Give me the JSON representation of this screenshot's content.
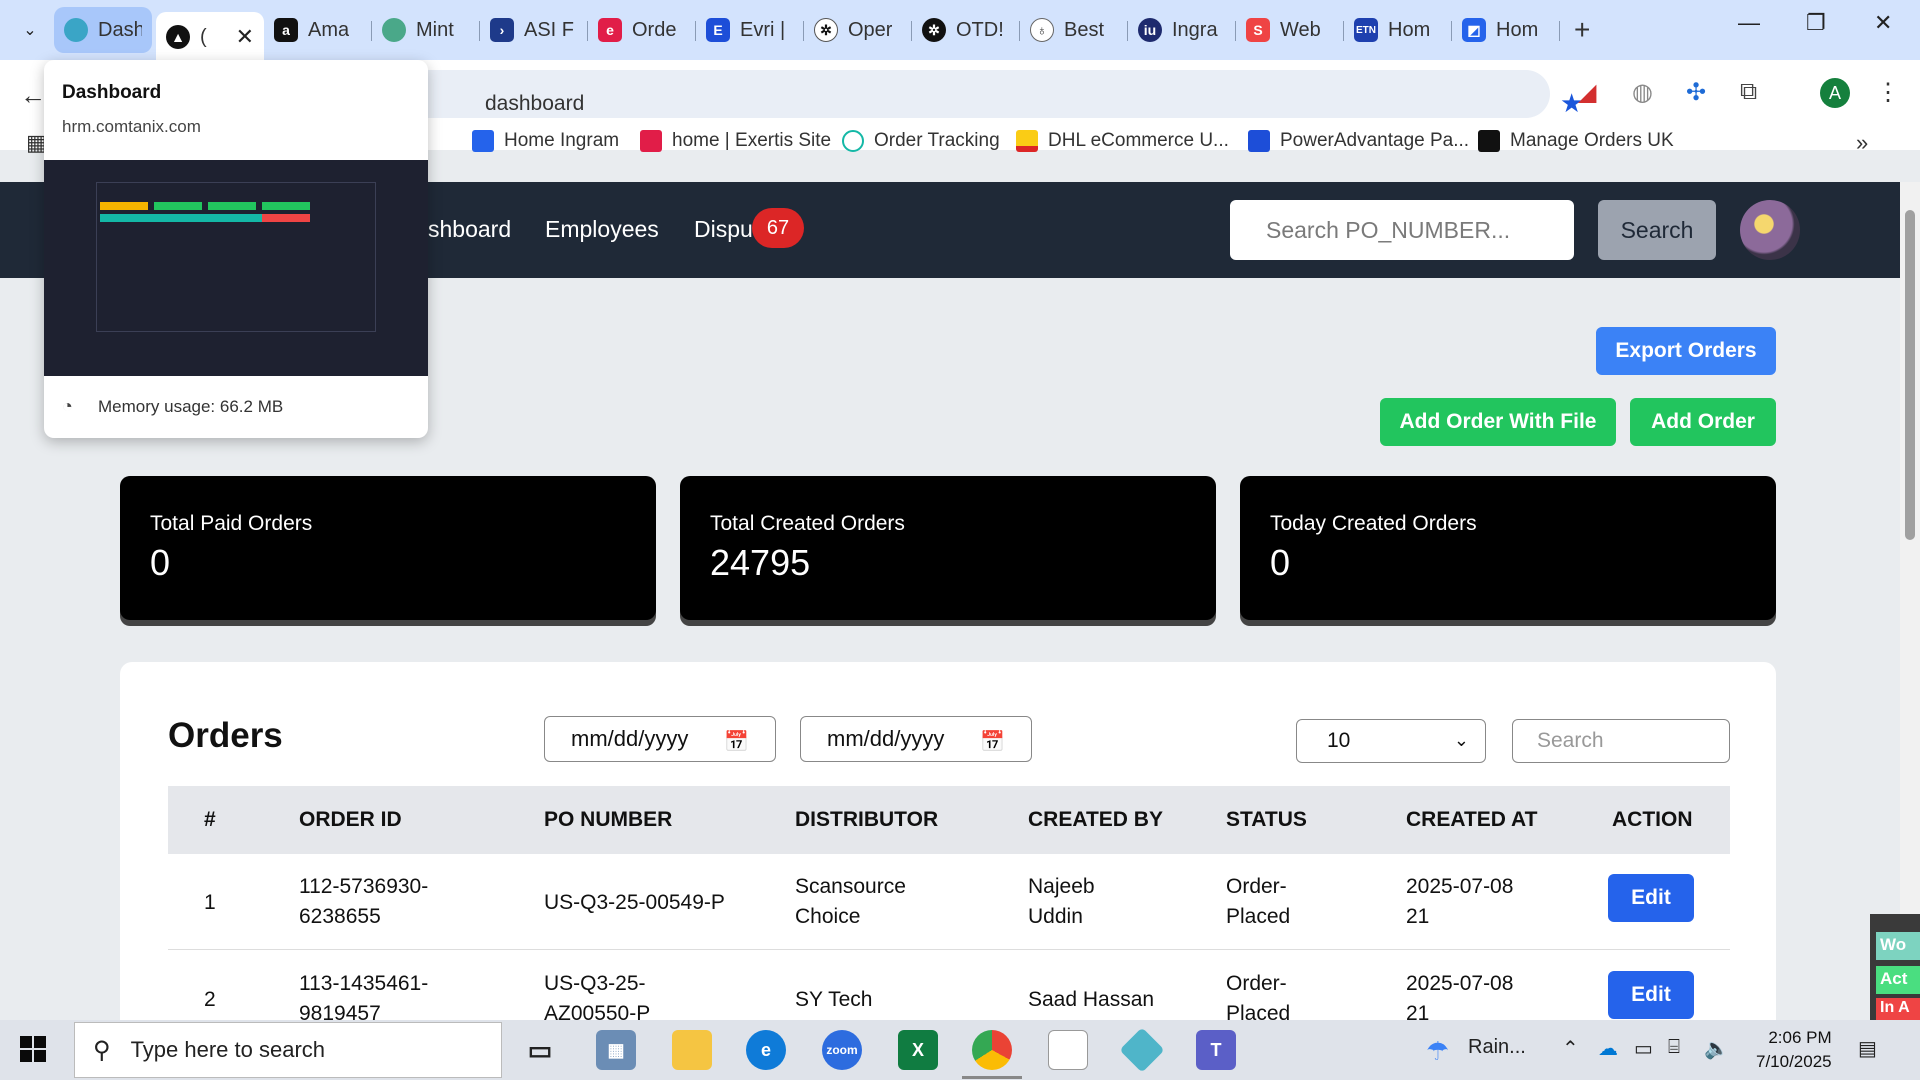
{
  "browser": {
    "tabs": [
      {
        "label": "Dash",
        "icon": "tab-favicon"
      },
      {
        "label": "(",
        "icon": "tab-favicon"
      },
      {
        "label": "Ama",
        "icon": "amazon-icon"
      },
      {
        "label": "Mint",
        "icon": "mint-icon"
      },
      {
        "label": "ASI F",
        "icon": "asi-icon"
      },
      {
        "label": "Orde",
        "icon": "exertis-icon"
      },
      {
        "label": "Evri |",
        "icon": "evri-icon"
      },
      {
        "label": "Oper",
        "icon": "openai-icon"
      },
      {
        "label": "OTD!",
        "icon": "openai-icon"
      },
      {
        "label": "Best",
        "icon": "bulb-icon"
      },
      {
        "label": "Ingra",
        "icon": "ingram-icon"
      },
      {
        "label": "Web",
        "icon": "web-icon"
      },
      {
        "label": "Hom",
        "icon": "etn-icon"
      },
      {
        "label": "Hom",
        "icon": "home-icon"
      }
    ],
    "url": "dashboard",
    "bookmarks": [
      "Home Ingram",
      "home | Exertis Site",
      "Order Tracking",
      "DHL eCommerce U...",
      "PowerAdvantage Pa...",
      "Manage Orders UK"
    ],
    "profile_initial": "A",
    "colors": {
      "tabstrip": "#d3e3fd",
      "star": "#1a56db"
    }
  },
  "preview": {
    "title": "Dashboard",
    "url": "hrm.comtanix.com",
    "memory": "Memory usage: 66.2 MB"
  },
  "app": {
    "nav": {
      "dashboard": "shboard",
      "employees": "Employees",
      "disputes": "Dispu",
      "disputes_badge": "67"
    },
    "search_placeholder": "Search PO_NUMBER...",
    "search_button": "Search",
    "buttons": {
      "export": "Export Orders",
      "add_with_file": "Add Order With File",
      "add": "Add Order"
    },
    "stats": [
      {
        "label": "Total Paid Orders",
        "value": "0"
      },
      {
        "label": "Total Created Orders",
        "value": "24795"
      },
      {
        "label": "Today Created Orders",
        "value": "0"
      }
    ],
    "orders": {
      "title": "Orders",
      "date_from": "mm/dd/yyyy",
      "date_to": "mm/dd/yyyy",
      "per_page": "10",
      "search_placeholder": "Search",
      "columns": [
        "#",
        "ORDER ID",
        "PO NUMBER",
        "DISTRIBUTOR",
        "CREATED BY",
        "STATUS",
        "CREATED AT",
        "ACTION"
      ],
      "rows": [
        {
          "num": "1",
          "order_id_1": "112-5736930-",
          "order_id_2": "6238655",
          "po_1": "US-Q3-25-00549-P",
          "po_2": "",
          "dist_1": "Scansource",
          "dist_2": "Choice",
          "by_1": "Najeeb",
          "by_2": "Uddin",
          "status_1": "Order-",
          "status_2": "Placed",
          "at_1": "2025-07-08",
          "at_2": "21",
          "action": "Edit"
        },
        {
          "num": "2",
          "order_id_1": "113-1435461-",
          "order_id_2": "9819457",
          "po_1": "US-Q3-25-",
          "po_2": "AZ00550-P",
          "dist_1": "SY Tech",
          "dist_2": "",
          "by_1": "Saad Hassan",
          "by_2": "",
          "status_1": "Order-",
          "status_2": "Placed",
          "at_1": "2025-07-08",
          "at_2": "21",
          "action": "Edit"
        }
      ]
    },
    "colors": {
      "navbar": "#1f2937",
      "blue": "#3b82f6",
      "green": "#22c55e",
      "badge": "#dc2626"
    }
  },
  "taskbar": {
    "search_placeholder": "Type here to search",
    "weather": "Rain...",
    "time": "2:06 PM",
    "date": "7/10/2025",
    "side_labels": [
      "Wo",
      "Act",
      "In A"
    ]
  }
}
